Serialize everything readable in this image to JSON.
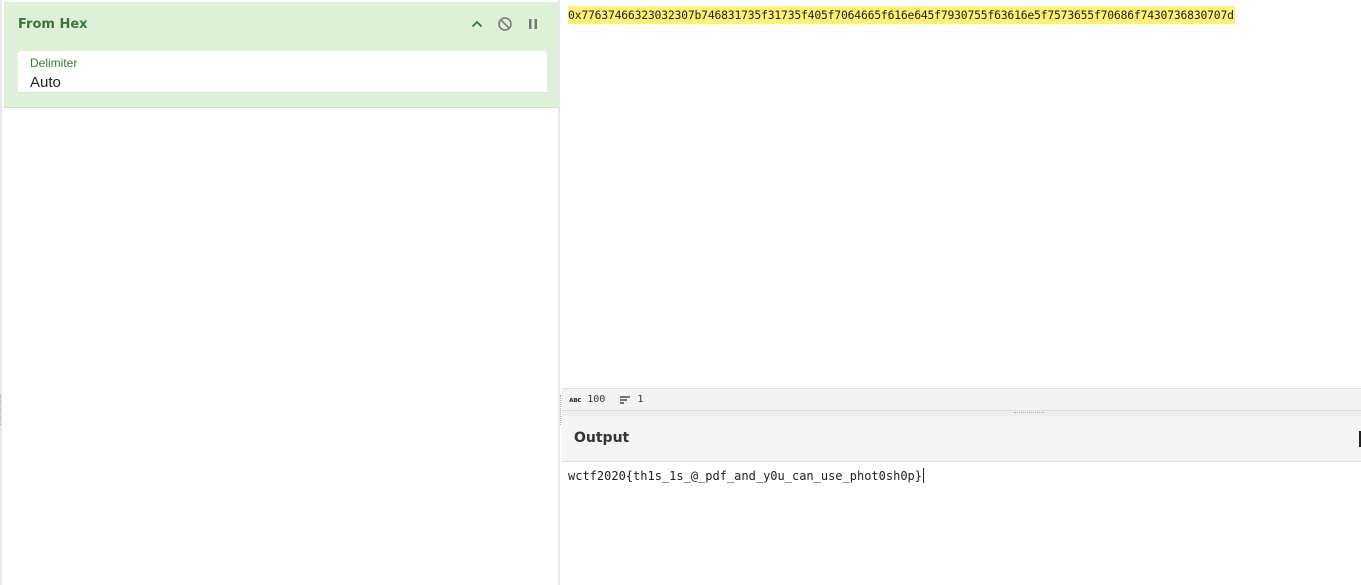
{
  "recipe": {
    "operation": {
      "title": "From Hex",
      "arg_label": "Delimiter",
      "arg_value": "Auto",
      "controls": {
        "collapse_icon": "chevron-up-icon",
        "disable_icon": "disable-icon",
        "breakpoint_icon": "pause-icon"
      }
    }
  },
  "input": {
    "text": "0x77637466323032307b746831735f31735f405f7064665f616e645f7930755f63616e5f7573655f70686f7430736830707d",
    "highlight_color": "#fff176"
  },
  "status_bar": {
    "length_icon": "abc-icon",
    "length": "100",
    "lines_icon": "lines-icon",
    "lines": "1"
  },
  "output": {
    "title": "Output",
    "text": "wctf2020{th1s_1s_@_pdf_and_y0u_can_use_phot0sh0p}"
  },
  "colors": {
    "operation_bg": "#dff0d8",
    "operation_text": "#3c763d"
  }
}
